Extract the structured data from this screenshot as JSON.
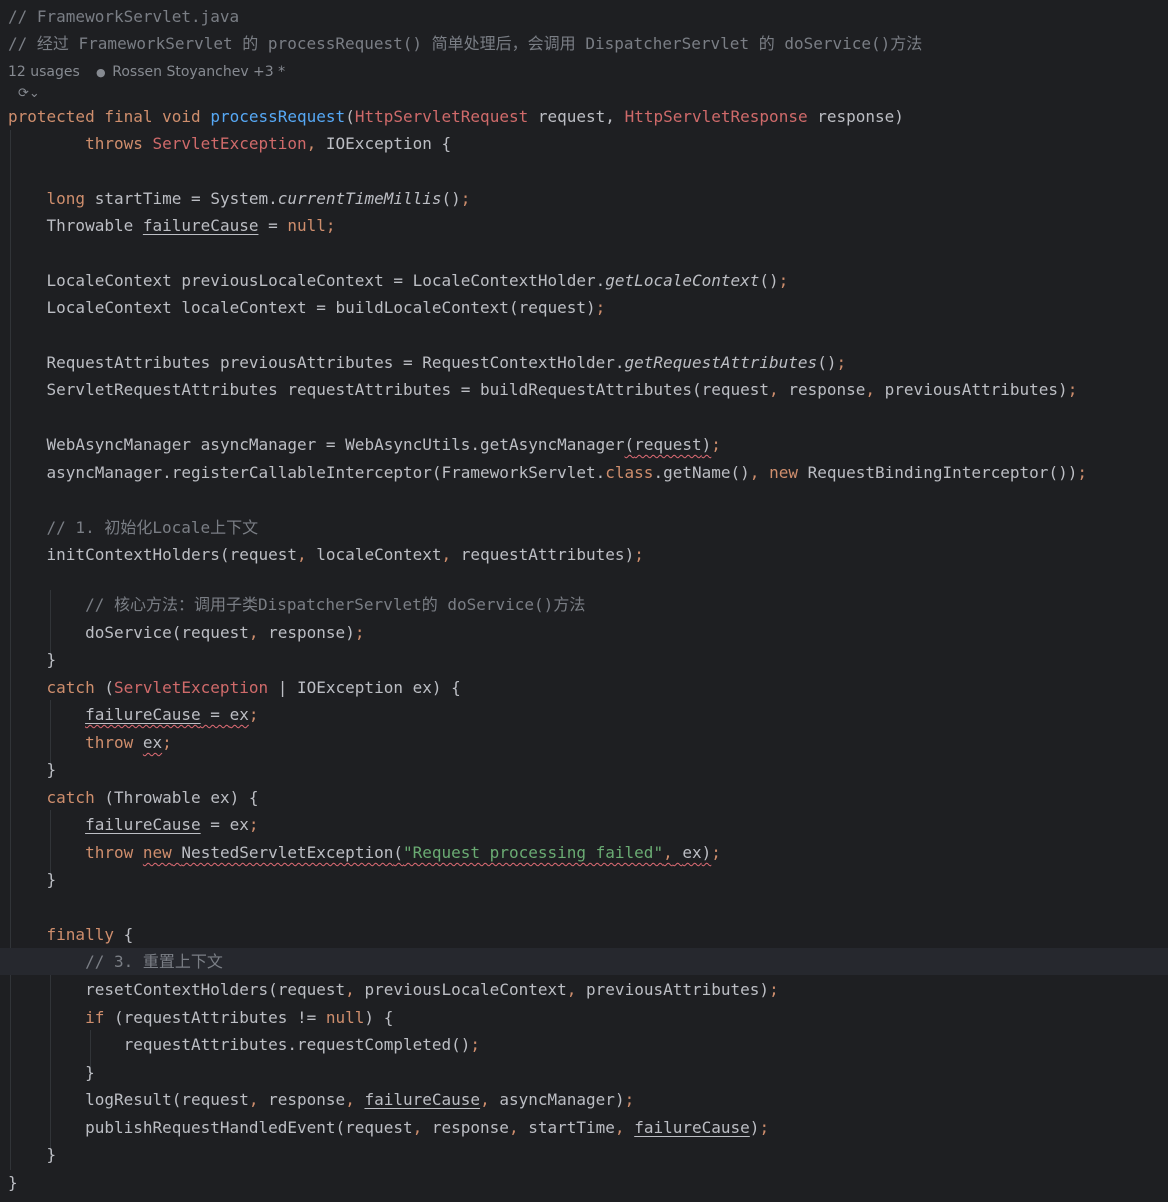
{
  "file_comment": "// FrameworkServlet.java",
  "desc_comment": "// 经过 FrameworkServlet 的 processRequest() 简单处理后，会调用 DispatcherServlet 的 doService()方法",
  "inlay": {
    "usages": "12 usages",
    "author": "Rossen Stoyanchev +3 *"
  },
  "kw": {
    "protected": "protected",
    "final": "final",
    "void": "void",
    "throws": "throws",
    "long": "long",
    "null": "null",
    "class": "class",
    "new": "new",
    "catch": "catch",
    "throw": "throw",
    "finally": "finally",
    "if": "if"
  },
  "types": {
    "req": "HttpServletRequest",
    "resp": "HttpServletResponse",
    "servlet_ex": "ServletException",
    "io_ex": "IOException",
    "throwable": "Throwable",
    "locale_ctx": "LocaleContext",
    "locale_holder": "LocaleContextHolder",
    "req_attrs": "RequestAttributes",
    "req_holder": "RequestContextHolder",
    "servlet_req_attrs": "ServletRequestAttributes",
    "async_mgr": "WebAsyncManager",
    "async_utils": "WebAsyncUtils",
    "fw_servlet": "FrameworkServlet",
    "rbi": "RequestBindingInterceptor",
    "nested_ex": "NestedServletException",
    "system": "System"
  },
  "ids": {
    "process": "processRequest",
    "request": "request",
    "response": "response",
    "start_time": "startTime",
    "failure": "failureCause",
    "current_millis": "currentTimeMillis",
    "prev_locale": "previousLocaleContext",
    "get_locale": "getLocaleContext",
    "locale_ctx_var": "localeContext",
    "build_locale": "buildLocaleContext",
    "prev_attrs": "previousAttributes",
    "get_req_attrs": "getRequestAttributes",
    "req_attrs_var": "requestAttributes",
    "build_req_attrs": "buildRequestAttributes",
    "async_mgr_var": "asyncManager",
    "get_async": "getAsyncManager",
    "register": "registerCallableInterceptor",
    "get_name": "getName",
    "init_holders": "initContextHolders",
    "do_service": "doService",
    "ex": "ex",
    "reset_holders": "resetContextHolders",
    "req_completed": "requestCompleted",
    "log_result": "logResult",
    "publish": "publishRequestHandledEvent"
  },
  "comments": {
    "step1": "// 1. 初始化Locale上下文",
    "core": "// 核心方法：调用子类DispatcherServlet的 doService()方法",
    "step3": "// 3. 重置上下文"
  },
  "strings": {
    "failed": "\"Request processing failed\""
  }
}
